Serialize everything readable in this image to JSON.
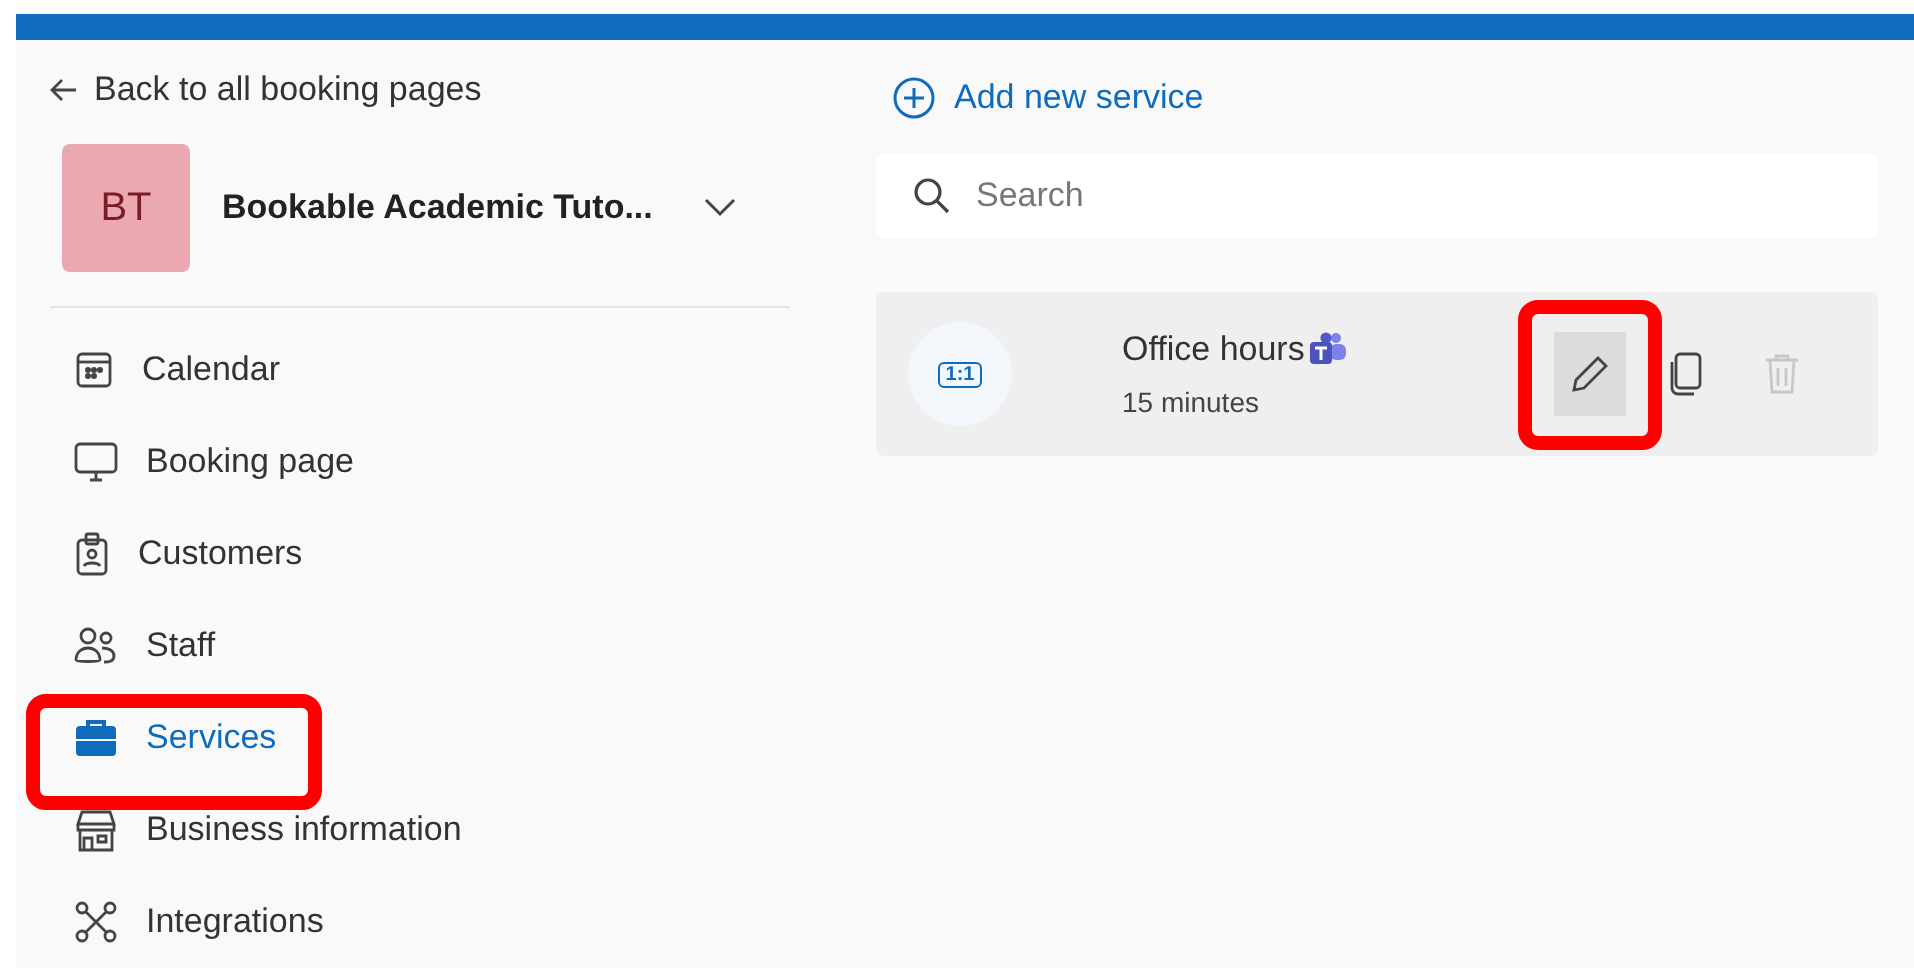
{
  "back_link": "Back to all booking pages",
  "business": {
    "initials": "BT",
    "name": "Bookable Academic Tuto..."
  },
  "nav": [
    {
      "kind": "calendar",
      "label": "Calendar",
      "selected": false,
      "highlighted": false
    },
    {
      "kind": "monitor",
      "label": "Booking page",
      "selected": false,
      "highlighted": false
    },
    {
      "kind": "badge",
      "label": "Customers",
      "selected": false,
      "highlighted": false
    },
    {
      "kind": "people",
      "label": "Staff",
      "selected": false,
      "highlighted": false
    },
    {
      "kind": "briefcase",
      "label": "Services",
      "selected": true,
      "highlighted": true
    },
    {
      "kind": "store",
      "label": "Business information",
      "selected": false,
      "highlighted": false
    },
    {
      "kind": "network",
      "label": "Integrations",
      "selected": false,
      "highlighted": false
    }
  ],
  "add_service": "Add new service",
  "search": {
    "placeholder": "Search"
  },
  "services": [
    {
      "badge": "1:1",
      "name": "Office hours",
      "duration": "15 minutes",
      "teams": true,
      "edit_highlighted": true,
      "delete_disabled": true
    }
  ]
}
